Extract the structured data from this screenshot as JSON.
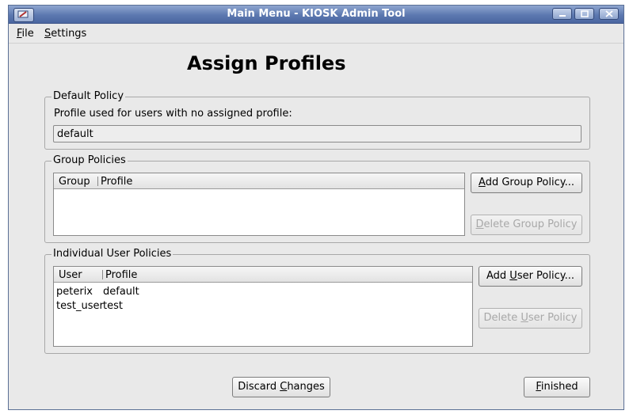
{
  "window": {
    "title": "Main Menu - KIOSK Admin Tool"
  },
  "menubar": {
    "file": {
      "mnemonic": "F",
      "rest": "ile"
    },
    "settings": {
      "mnemonic": "S",
      "rest": "ettings"
    }
  },
  "page": {
    "heading": "Assign Profiles"
  },
  "default_policy": {
    "legend": "Default Policy",
    "description": "Profile used for users with no assigned profile:",
    "profile_value": "default"
  },
  "group_policies": {
    "legend": "Group Policies",
    "columns": [
      "Group",
      "Profile"
    ],
    "rows": [],
    "add_button": {
      "pre": "",
      "mnemonic": "A",
      "post": "dd Group Policy..."
    },
    "delete_button": {
      "pre": "",
      "mnemonic": "D",
      "post": "elete Group Policy"
    }
  },
  "user_policies": {
    "legend": "Individual User Policies",
    "columns": [
      "User",
      "Profile"
    ],
    "rows": [
      {
        "user": "peterix",
        "profile": "default"
      },
      {
        "user": "test_user",
        "profile": "test"
      }
    ],
    "add_button": {
      "pre": "Add ",
      "mnemonic": "U",
      "post": "ser Policy..."
    },
    "delete_button": {
      "pre": "Delete ",
      "mnemonic": "U",
      "post": "ser Policy"
    }
  },
  "footer": {
    "discard_button": {
      "pre": "Discard ",
      "mnemonic": "C",
      "post": "hanges"
    },
    "finished_button": {
      "pre": "",
      "mnemonic": "F",
      "post": "inished"
    }
  }
}
